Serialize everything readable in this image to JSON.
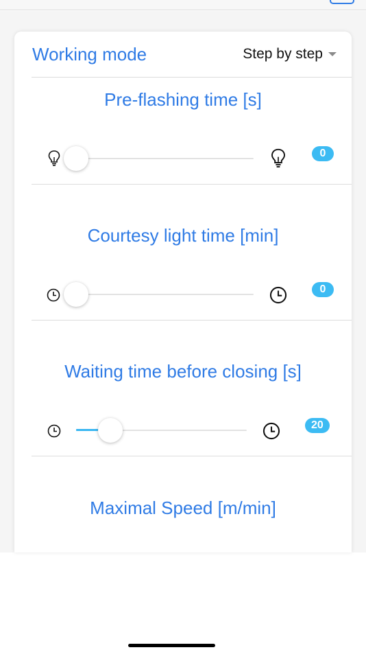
{
  "header": {
    "mode_label": "Working mode",
    "mode_value": "Step by step"
  },
  "sections": [
    {
      "title": "Pre-flashing time [s]",
      "value": "0",
      "slider_fraction": 0.0,
      "min_icon": "lightbulb-icon",
      "max_icon": "lightbulb-icon"
    },
    {
      "title": "Courtesy light time [min]",
      "value": "0",
      "slider_fraction": 0.0,
      "min_icon": "clock-icon",
      "max_icon": "clock-icon"
    },
    {
      "title": "Waiting time before closing [s]",
      "value": "20",
      "slider_fraction": 0.2,
      "min_icon": "clock-icon",
      "max_icon": "clock-icon"
    },
    {
      "title": "Maximal Speed [m/min]"
    }
  ],
  "colors": {
    "accent_text": "#2f7be5",
    "slider_fill": "#38b6f2",
    "badge": "#3cbbf3"
  }
}
